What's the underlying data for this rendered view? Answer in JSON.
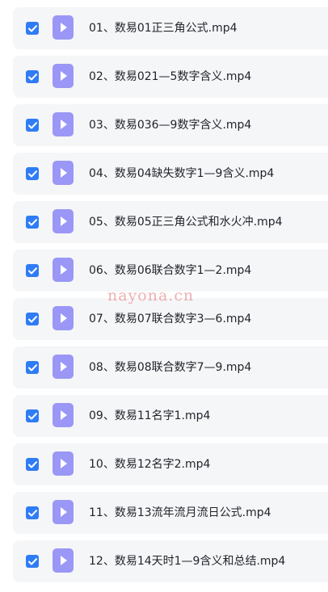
{
  "colors": {
    "checkbox": "#2f7cf6",
    "file_icon": "#9a97f6",
    "row_background": "#f5f6f8",
    "watermark": "#e56e6e"
  },
  "icons": {
    "checkbox": "checkmark-icon",
    "file": "video-file-play-icon"
  },
  "files": [
    {
      "name": "01、数易01正三角公式.mp4",
      "checked": true
    },
    {
      "name": "02、数易021—5数字含义.mp4",
      "checked": true
    },
    {
      "name": "03、数易036—9数字含义.mp4",
      "checked": true
    },
    {
      "name": "04、数易04缺失数字1—9含义.mp4",
      "checked": true
    },
    {
      "name": "05、数易05正三角公式和水火冲.mp4",
      "checked": true
    },
    {
      "name": "06、数易06联合数字1—2.mp4",
      "checked": true
    },
    {
      "name": "07、数易07联合数字3—6.mp4",
      "checked": true
    },
    {
      "name": "08、数易08联合数字7—9.mp4",
      "checked": true
    },
    {
      "name": "09、数易11名字1.mp4",
      "checked": true
    },
    {
      "name": "10、数易12名字2.mp4",
      "checked": true
    },
    {
      "name": "11、数易13流年流月流日公式.mp4",
      "checked": true
    },
    {
      "name": "12、数易14天时1—9含义和总结.mp4",
      "checked": true
    }
  ],
  "watermark": "nayona.cn"
}
